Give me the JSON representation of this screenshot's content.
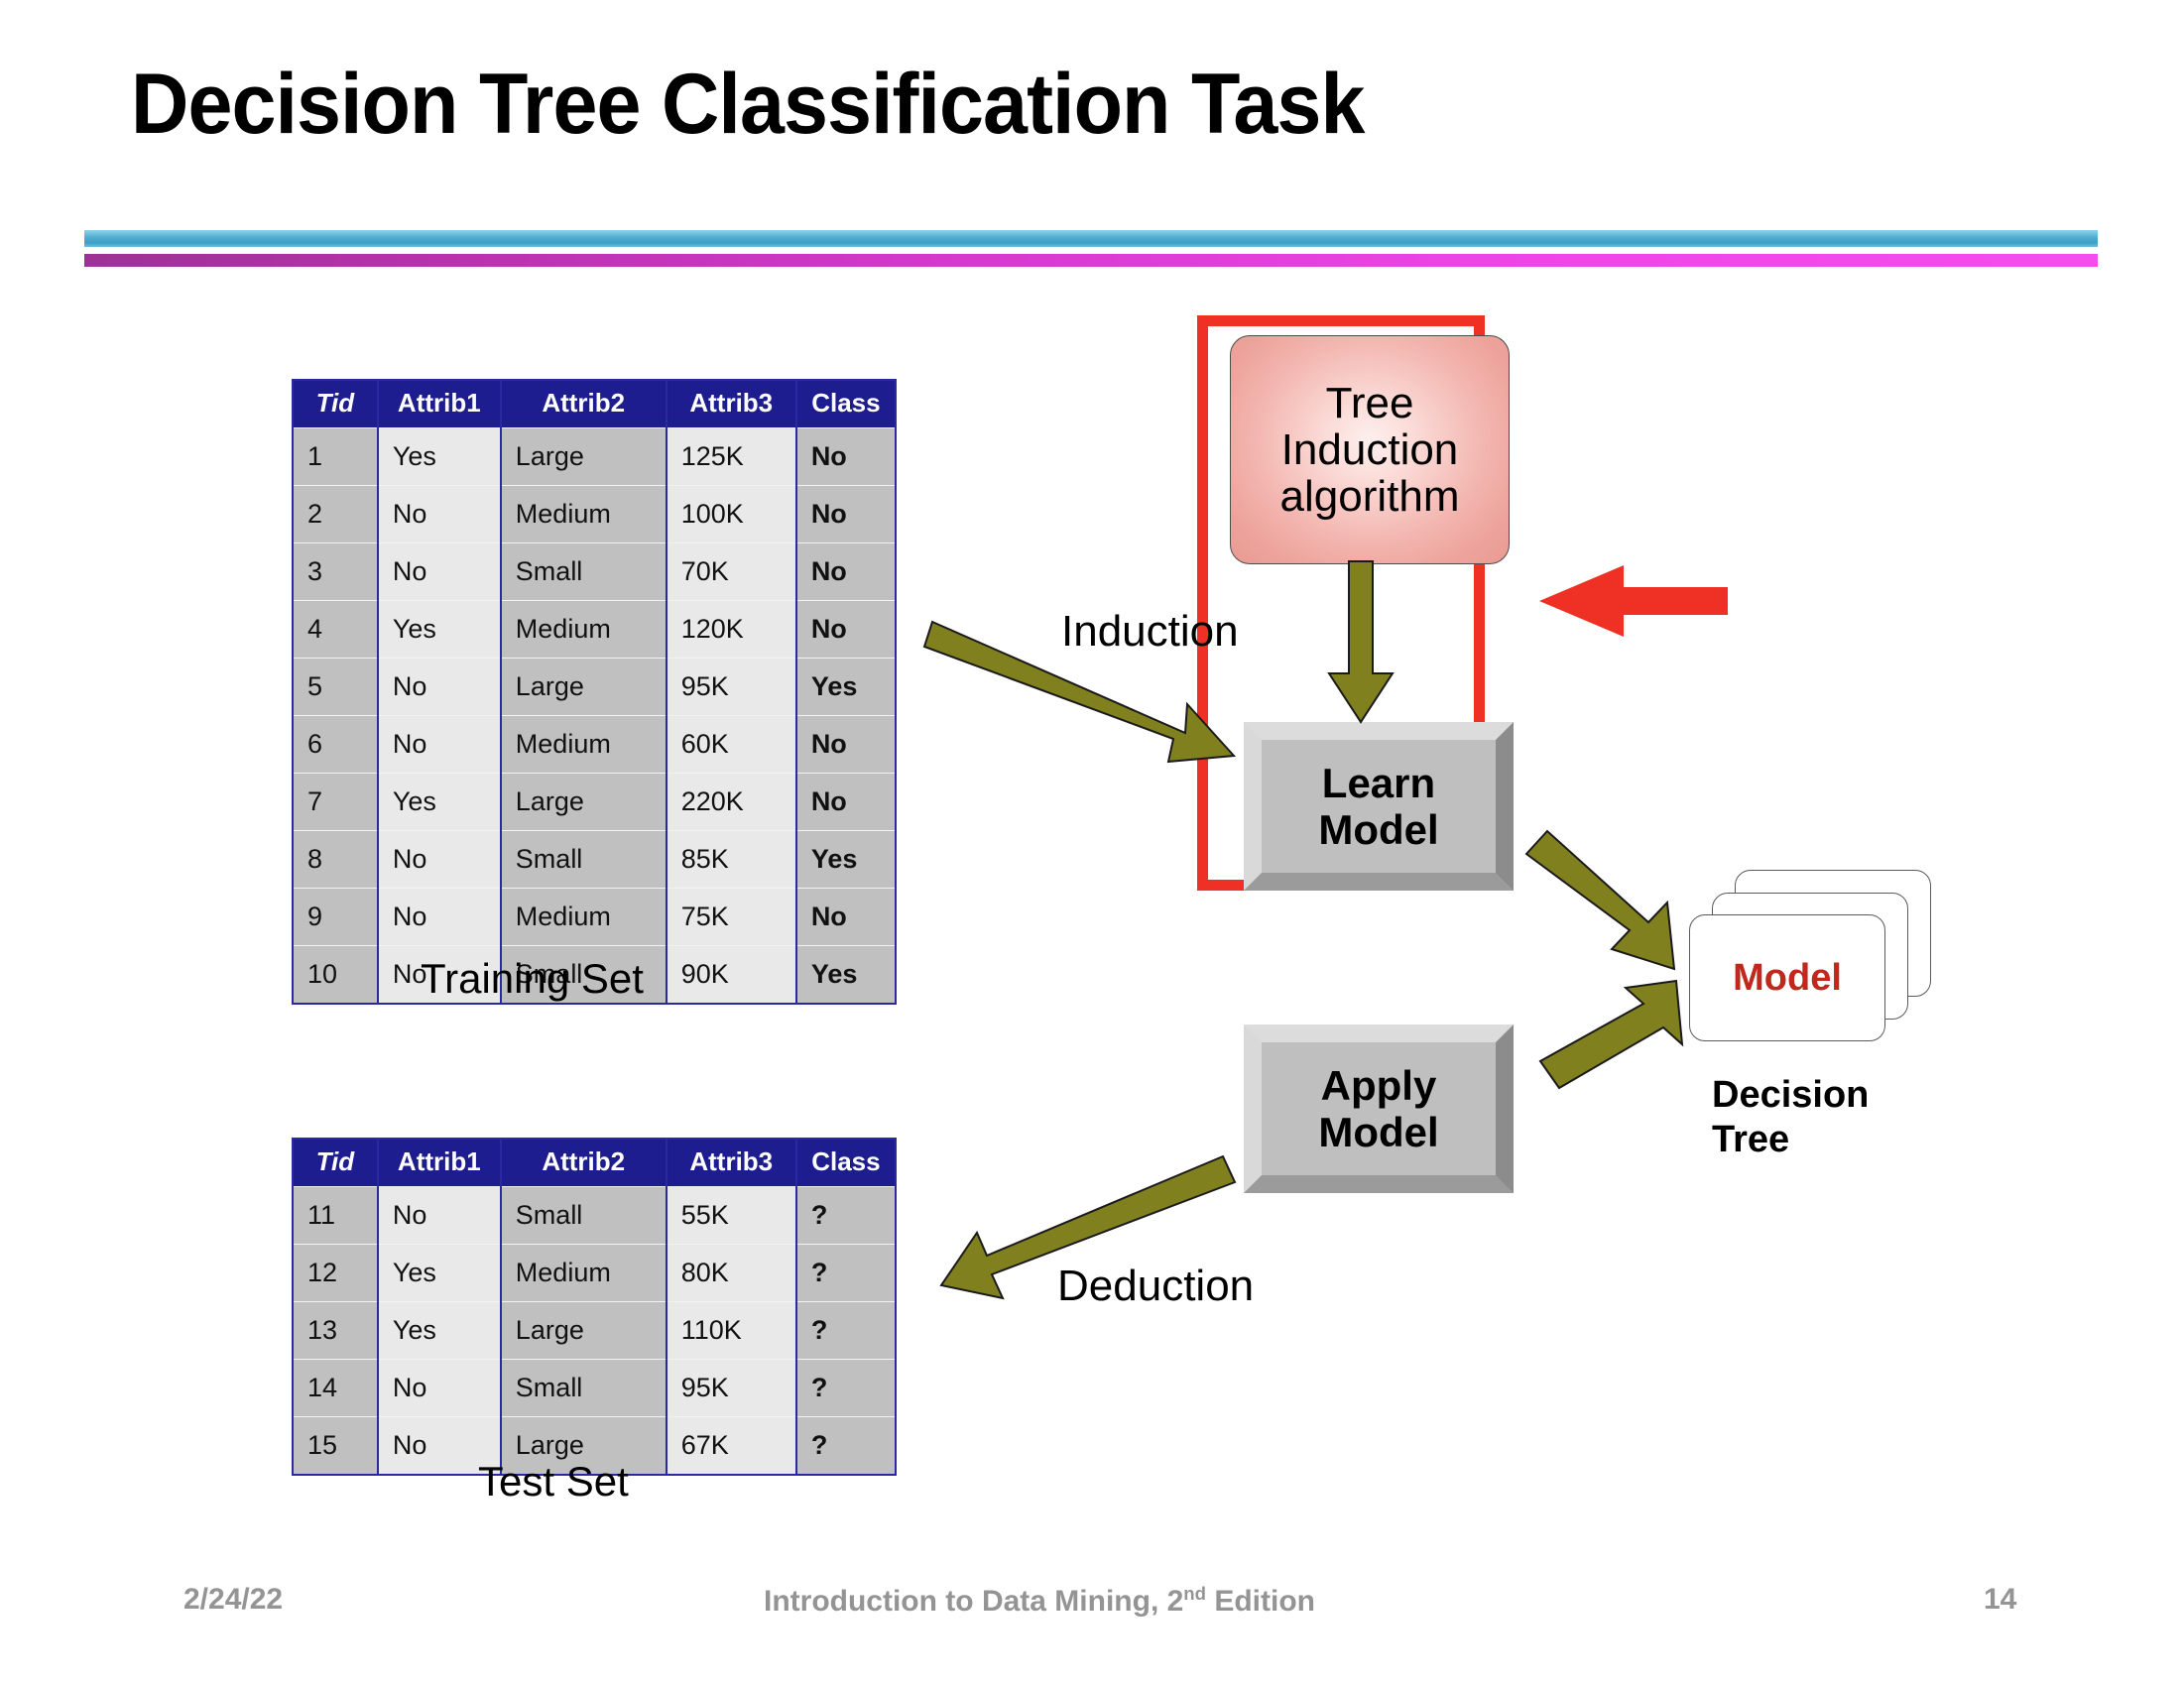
{
  "slide": {
    "title": "Decision Tree Classification Task",
    "page_number": "14",
    "date": "2/24/22",
    "footer_text_prefix": "Introduction to Data Mining, 2",
    "footer_superscript": "nd",
    "footer_text_suffix": " Edition"
  },
  "colors": {
    "accent_blue": "#4fadcf",
    "accent_magenta": "#d739cf",
    "table_header_navy": "#1d1d8f",
    "class_red": "#e8201a",
    "box_red": "#ee3124",
    "arrow_olive": "#81801f",
    "model_red": "#c0271d"
  },
  "tables": {
    "training": {
      "caption": "Training Set",
      "columns": [
        "Tid",
        "Attrib1",
        "Attrib2",
        "Attrib3",
        "Class"
      ],
      "rows": [
        [
          "1",
          "Yes",
          "Large",
          "125K",
          "No"
        ],
        [
          "2",
          "No",
          "Medium",
          "100K",
          "No"
        ],
        [
          "3",
          "No",
          "Small",
          "70K",
          "No"
        ],
        [
          "4",
          "Yes",
          "Medium",
          "120K",
          "No"
        ],
        [
          "5",
          "No",
          "Large",
          "95K",
          "Yes"
        ],
        [
          "6",
          "No",
          "Medium",
          "60K",
          "No"
        ],
        [
          "7",
          "Yes",
          "Large",
          "220K",
          "No"
        ],
        [
          "8",
          "No",
          "Small",
          "85K",
          "Yes"
        ],
        [
          "9",
          "No",
          "Medium",
          "75K",
          "No"
        ],
        [
          "10",
          "No",
          "Small",
          "90K",
          "Yes"
        ]
      ]
    },
    "test": {
      "caption": "Test Set",
      "columns": [
        "Tid",
        "Attrib1",
        "Attrib2",
        "Attrib3",
        "Class"
      ],
      "rows": [
        [
          "11",
          "No",
          "Small",
          "55K",
          "?"
        ],
        [
          "12",
          "Yes",
          "Medium",
          "80K",
          "?"
        ],
        [
          "13",
          "Yes",
          "Large",
          "110K",
          "?"
        ],
        [
          "14",
          "No",
          "Small",
          "95K",
          "?"
        ],
        [
          "15",
          "No",
          "Large",
          "67K",
          "?"
        ]
      ]
    }
  },
  "diagram": {
    "tree_induction_label": "Tree\nInduction\nalgorithm",
    "learn_model_label": "Learn\nModel",
    "apply_model_label": "Apply\nModel",
    "model_card_label": "Model",
    "decision_tree_caption": "Decision\nTree",
    "induction_label": "Induction",
    "deduction_label": "Deduction"
  },
  "chart_data": {
    "type": "table",
    "title": "Decision Tree Classification Task",
    "description": "Training set of 10 labeled records and test set of 5 unlabeled records feeding a tree induction workflow",
    "series": [
      {
        "name": "Training Set",
        "columns": [
          "Tid",
          "Attrib1",
          "Attrib2",
          "Attrib3",
          "Class"
        ],
        "values": [
          [
            "1",
            "Yes",
            "Large",
            "125K",
            "No"
          ],
          [
            "2",
            "No",
            "Medium",
            "100K",
            "No"
          ],
          [
            "3",
            "No",
            "Small",
            "70K",
            "No"
          ],
          [
            "4",
            "Yes",
            "Medium",
            "120K",
            "No"
          ],
          [
            "5",
            "No",
            "Large",
            "95K",
            "Yes"
          ],
          [
            "6",
            "No",
            "Medium",
            "60K",
            "No"
          ],
          [
            "7",
            "Yes",
            "Large",
            "220K",
            "No"
          ],
          [
            "8",
            "No",
            "Small",
            "85K",
            "Yes"
          ],
          [
            "9",
            "No",
            "Medium",
            "75K",
            "No"
          ],
          [
            "10",
            "No",
            "Small",
            "90K",
            "Yes"
          ]
        ]
      },
      {
        "name": "Test Set",
        "columns": [
          "Tid",
          "Attrib1",
          "Attrib2",
          "Attrib3",
          "Class"
        ],
        "values": [
          [
            "11",
            "No",
            "Small",
            "55K",
            "?"
          ],
          [
            "12",
            "Yes",
            "Medium",
            "80K",
            "?"
          ],
          [
            "13",
            "Yes",
            "Large",
            "110K",
            "?"
          ],
          [
            "14",
            "No",
            "Small",
            "95K",
            "?"
          ],
          [
            "15",
            "No",
            "Large",
            "67K",
            "?"
          ]
        ]
      }
    ]
  }
}
